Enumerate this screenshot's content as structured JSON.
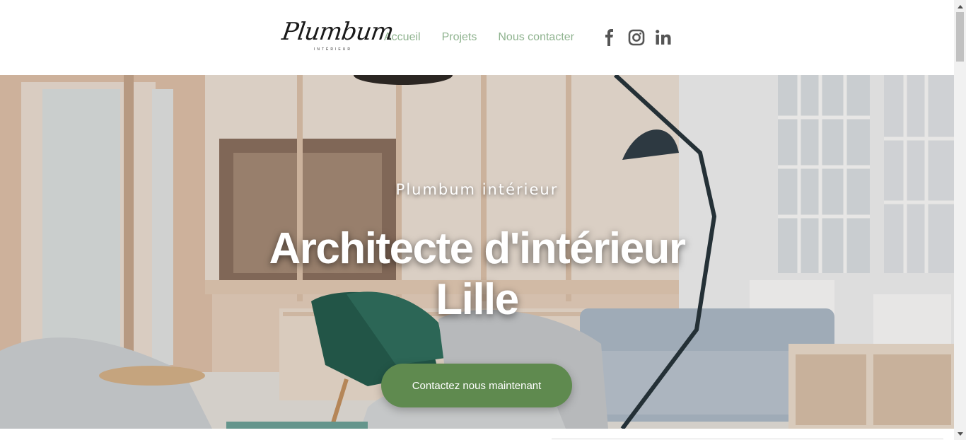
{
  "brand": {
    "logo_script": "Plumbum",
    "logo_sub": "INTÉRIEUR"
  },
  "nav": {
    "items": [
      {
        "label": "Accueil"
      },
      {
        "label": "Projets"
      },
      {
        "label": "Nous contacter"
      }
    ]
  },
  "socials": [
    {
      "icon": "facebook-icon"
    },
    {
      "icon": "instagram-icon"
    },
    {
      "icon": "linkedin-icon"
    }
  ],
  "hero": {
    "kicker": "Plumbum intérieur",
    "title_line1": "Architecte d'intérieur",
    "title_line2": "Lille",
    "cta_label": "Contactez nous maintenant"
  },
  "colors": {
    "nav_link": "#8fb38f",
    "cta_bg": "#5f8a4f",
    "social_icon": "#555555"
  }
}
